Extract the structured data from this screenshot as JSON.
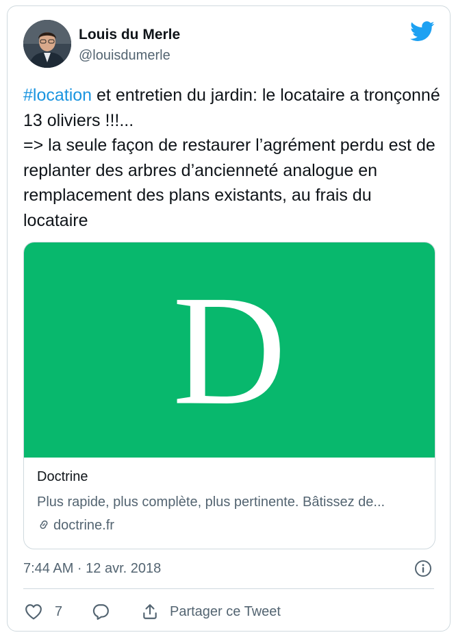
{
  "author": {
    "name": "Louis du Merle",
    "handle": "@louisdumerle"
  },
  "tweet": {
    "hashtag": "#location",
    "text": " et entretien du jardin: le locataire a tronçonné 13 oliviers !!!...\n=> la seule façon de restaurer l’agrément perdu est de replanter des arbres d’ancienneté analogue en remplacement des plans existants, au frais du locataire"
  },
  "card": {
    "logo_letter": "D",
    "title": "Doctrine",
    "description": "Plus rapide, plus complète, plus pertinente. Bâtissez de...",
    "domain": "doctrine.fr",
    "image_color": "#08b86d"
  },
  "meta": {
    "timestamp": "7:44 AM · 12 avr. 2018"
  },
  "actions": {
    "like_count": "7",
    "share_label": "Partager ce Tweet"
  },
  "colors": {
    "accent": "#1da1f2",
    "hashtag": "#1b95e0",
    "muted": "#536471",
    "border": "#cfd9de"
  },
  "icons": [
    "avatar-photo",
    "twitter-bird-icon",
    "link-icon",
    "info-icon",
    "heart-icon",
    "reply-icon",
    "share-icon"
  ]
}
